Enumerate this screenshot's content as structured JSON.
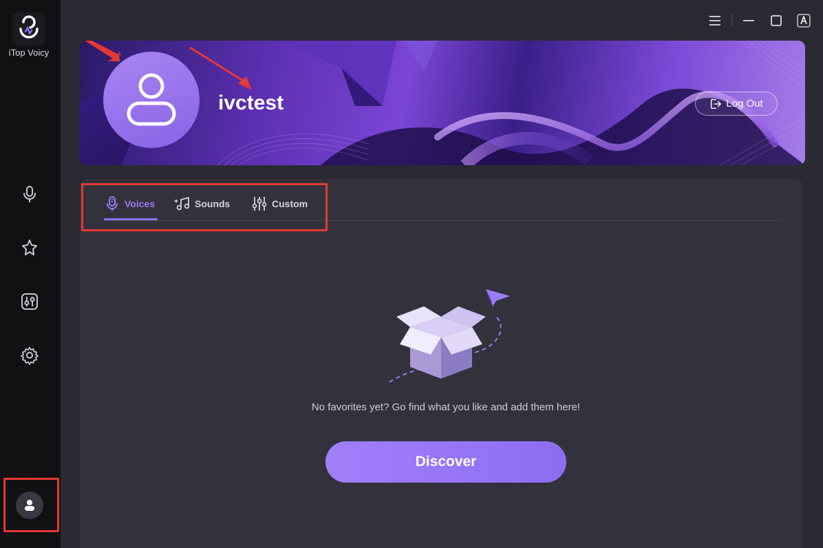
{
  "app": {
    "name": "iTop Voicy"
  },
  "sidebar": {
    "items": [
      {
        "icon": "microphone-icon"
      },
      {
        "icon": "star-icon"
      },
      {
        "icon": "equalizer-icon"
      },
      {
        "icon": "gear-icon"
      }
    ],
    "account_icon": "user-avatar-icon"
  },
  "window_controls": [
    "menu-icon",
    "minimize-icon",
    "maximize-icon",
    "translate-icon"
  ],
  "profile": {
    "username": "ivctest",
    "logout_label": "Log Out"
  },
  "tabs": [
    {
      "label": "Voices",
      "icon": "mic-tab-icon",
      "active": true
    },
    {
      "label": "Sounds",
      "icon": "music-note-icon",
      "active": false
    },
    {
      "label": "Custom",
      "icon": "sliders-icon",
      "active": false
    }
  ],
  "empty_state": {
    "message": "No favorites yet? Go find what you like and add them here!",
    "button_label": "Discover"
  },
  "colors": {
    "accent": "#9b7cf6",
    "sidebar_bg": "#111114",
    "panel_bg": "#33323c",
    "highlight": "#e53935"
  }
}
